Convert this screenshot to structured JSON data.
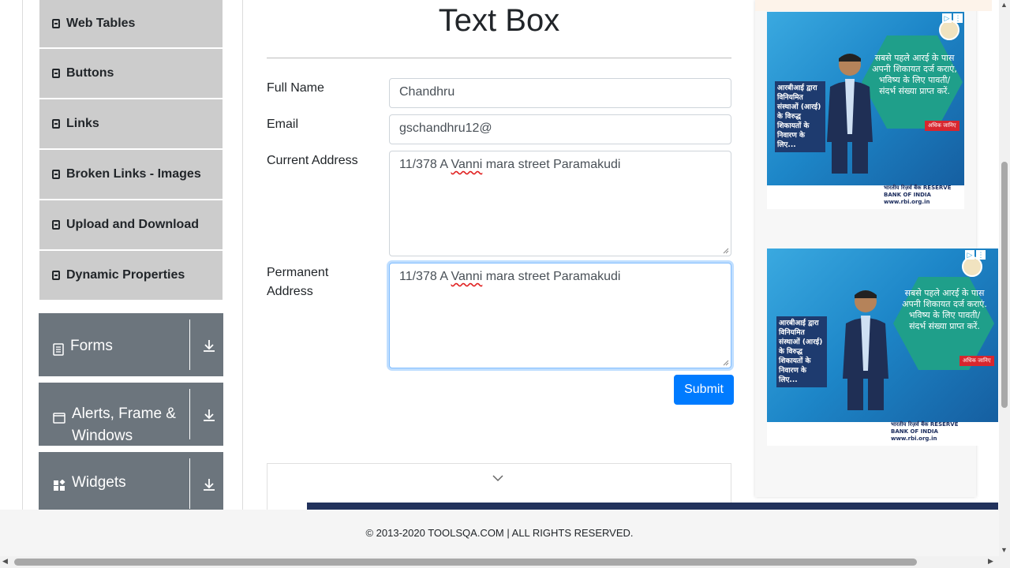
{
  "sidebar": {
    "elements_items": [
      {
        "label": "Web Tables"
      },
      {
        "label": "Buttons"
      },
      {
        "label": "Links"
      },
      {
        "label": "Broken Links - Images"
      },
      {
        "label": "Upload and Download"
      },
      {
        "label": "Dynamic Properties"
      }
    ],
    "groups": [
      {
        "label": "Forms",
        "icon": "form-icon"
      },
      {
        "label": "Alerts, Frame & Windows",
        "icon": "window-icon"
      },
      {
        "label": "Widgets",
        "icon": "widgets-icon"
      }
    ]
  },
  "main": {
    "title": "Text Box",
    "full_name_label": "Full Name",
    "full_name_value": "Chandhru",
    "email_label": "Email",
    "email_value": "gschandhru12@",
    "current_address_label": "Current Address",
    "current_address_value_pre": "11/378 A ",
    "current_address_value_mis": "Vanni",
    "current_address_value_post": " mara street Paramakudi",
    "permanent_address_label_1": "Permanent",
    "permanent_address_label_2": "Address",
    "permanent_address_value_pre": "11/378 A ",
    "permanent_address_value_mis": "Vanni",
    "permanent_address_value_post": " mara street Paramakudi",
    "submit_label": "Submit"
  },
  "ads": [
    {
      "hex_text": "सबसे पहले आरई के पास अपनी शिकायत दर्ज कराएं, भविष्य के लिए पावती/ संदर्भ संख्या प्राप्त करें.",
      "left_text": "आरबीआई द्वारा विनियमित संस्थाओं (आरई) के विरुद्ध शिकायतों के निवारण के लिए...",
      "badge": "अधिक जानिए",
      "rbi": "भारतीय रिज़र्व बैंक RESERVE BANK OF INDIA www.rbi.org.in"
    },
    {
      "hex_text": "सबसे पहले आरई के पास अपनी शिकायत दर्ज कराएं. भविष्य के लिए पावती/ संदर्भ संख्या प्राप्त करें.",
      "left_text": "आरबीआई द्वारा विनियमित संस्थाओं (आरई) के विरुद्ध शिकायतों के निवारण के लिए...",
      "badge": "अधिक जानिए",
      "rbi": "भारतीय रिज़र्व बैंक RESERVE BANK OF INDIA www.rbi.org.in"
    }
  ],
  "footer": {
    "text": "© 2013-2020 TOOLSQA.COM | ALL RIGHTS RESERVED."
  },
  "colors": {
    "primary": "#007bff",
    "sidebar_item": "#cccccc",
    "group_header": "#6c757d"
  }
}
